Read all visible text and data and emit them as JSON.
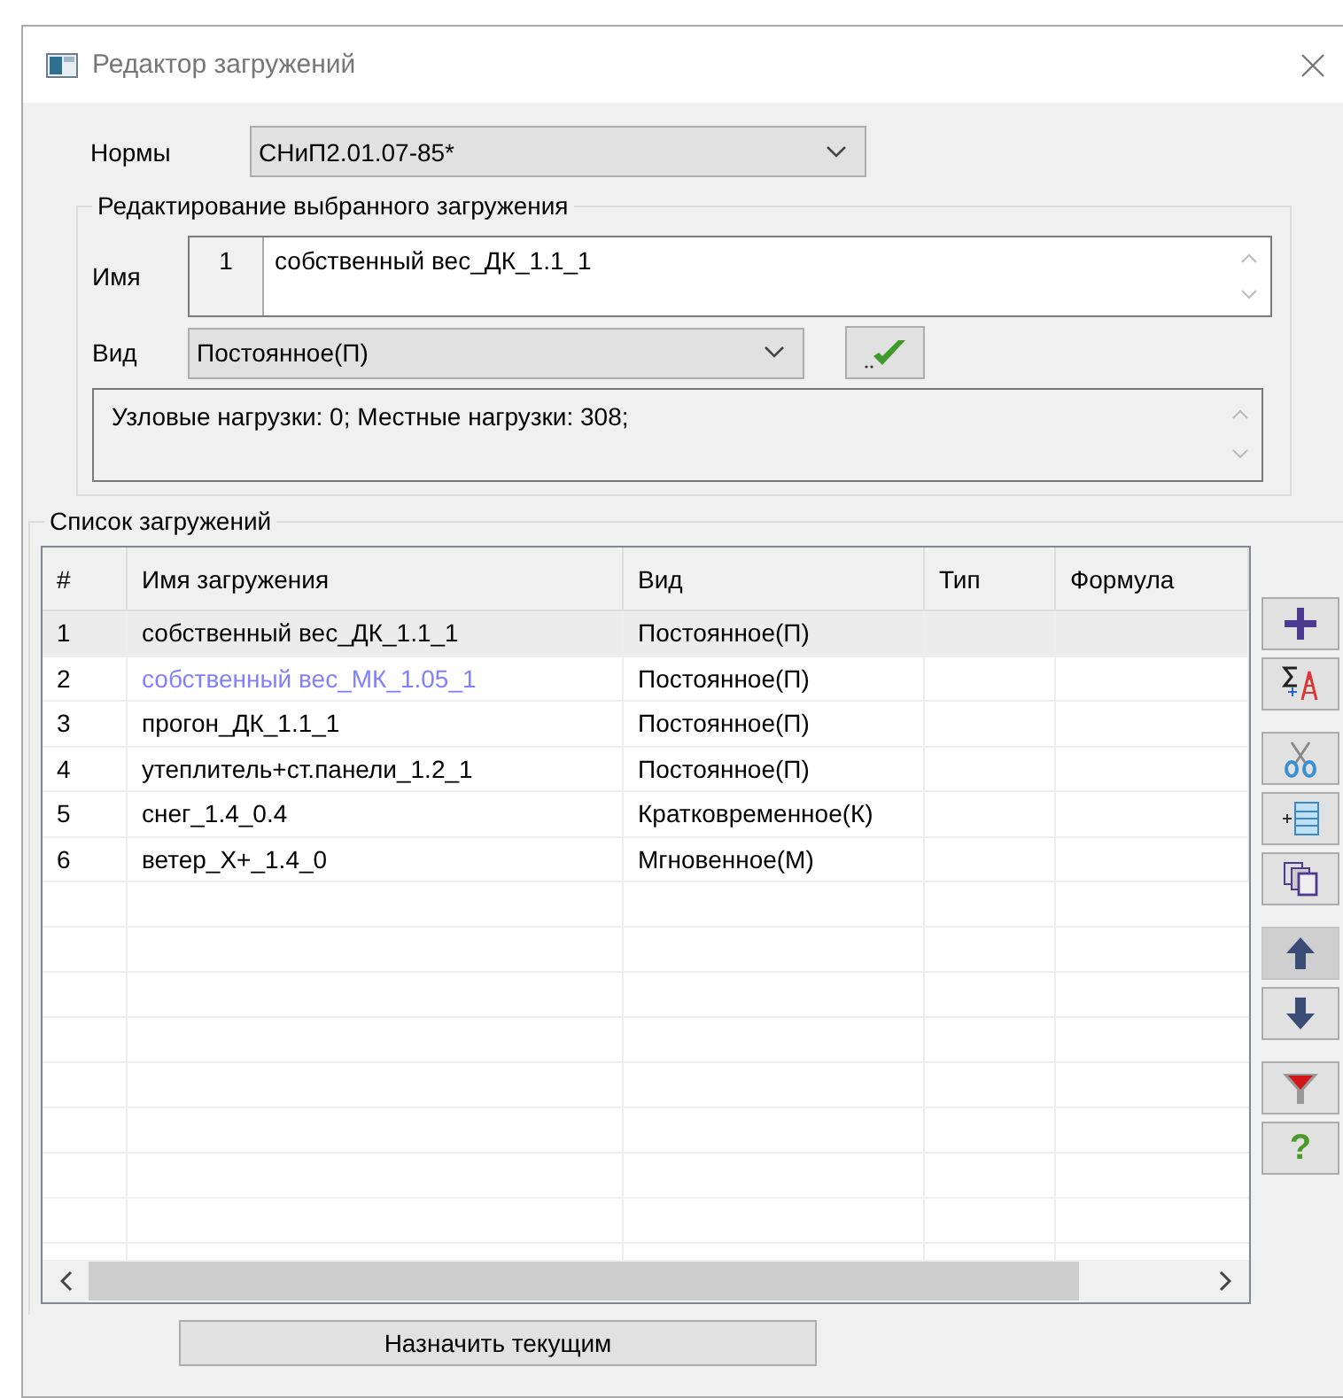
{
  "window": {
    "title": "Редактор загружений"
  },
  "norms": {
    "label": "Нормы",
    "value": "СНиП2.01.07-85*"
  },
  "edit_group": {
    "title": "Редактирование выбранного загружения",
    "name_label": "Имя",
    "number": "1",
    "name_value": "собственный вес_ДК_1.1_1",
    "type_label": "Вид",
    "type_value": "Постоянное(П)",
    "info": "Узловые нагрузки:  0;  Местные нагрузки:  308;"
  },
  "list_group": {
    "title": "Список загружений",
    "columns": [
      "#",
      "Имя загружения",
      "Вид",
      "Тип",
      "Формула"
    ],
    "rows": [
      {
        "cells": [
          "1",
          "собственный вес_ДК_1.1_1",
          "Постоянное(П)"
        ],
        "selected": true,
        "color": "#000000"
      },
      {
        "cells": [
          "2",
          "собственный вес_МК_1.05_1",
          "Постоянное(П)"
        ],
        "selected": false,
        "color": "#8080ff"
      },
      {
        "cells": [
          "3",
          "прогон_ДК_1.1_1",
          "Постоянное(П)"
        ],
        "selected": false,
        "color": "#000000"
      },
      {
        "cells": [
          "4",
          "утеплитель+ст.панели_1.2_1",
          "Постоянное(П)"
        ],
        "selected": false,
        "color": "#000000"
      },
      {
        "cells": [
          "5",
          "снег_1.4_0.4",
          "Кратковременное(К)"
        ],
        "selected": false,
        "color": "#000000"
      },
      {
        "cells": [
          "6",
          "ветер_X+_1.4_0",
          "Мгновенное(М)"
        ],
        "selected": false,
        "color": "#000000"
      }
    ],
    "tools": [
      {
        "kind": "add",
        "pressed": false
      },
      {
        "kind": "sum",
        "pressed": false
      },
      {
        "kind": "cut",
        "pressed": false
      },
      {
        "kind": "insert",
        "pressed": false
      },
      {
        "kind": "copy",
        "pressed": false
      },
      {
        "kind": "up",
        "pressed": true
      },
      {
        "kind": "down",
        "pressed": false
      },
      {
        "kind": "filter",
        "pressed": false
      },
      {
        "kind": "help",
        "pressed": false,
        "label": "?"
      }
    ]
  },
  "assign_button": "Назначить текущим"
}
